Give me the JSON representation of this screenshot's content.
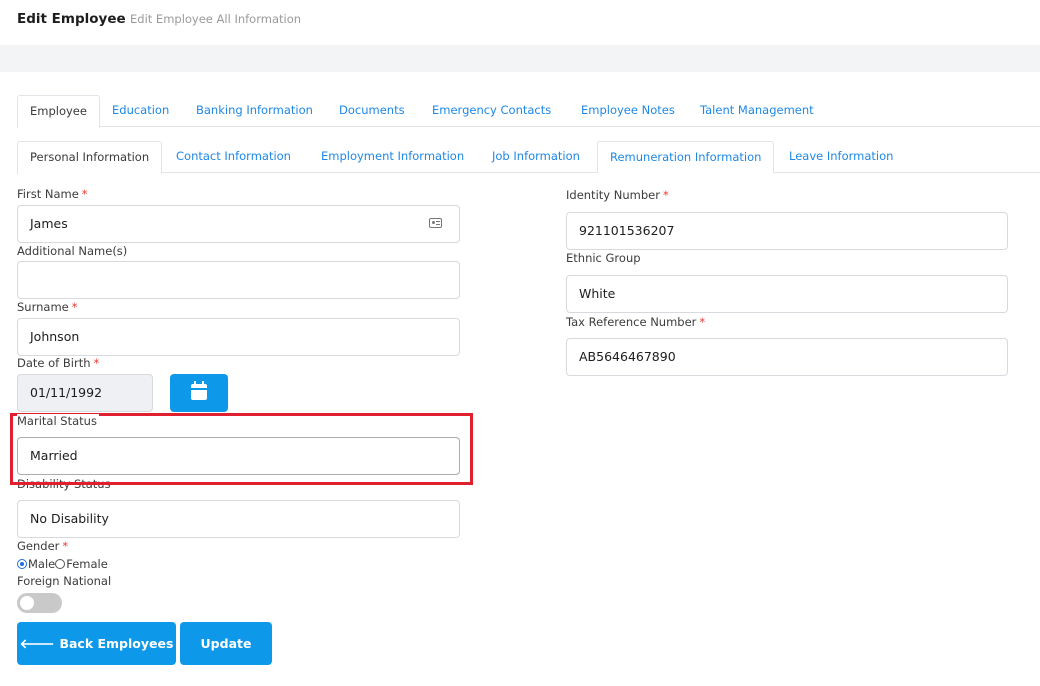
{
  "header": {
    "title": "Edit Employee",
    "subtitle": "Edit Employee All Information"
  },
  "tabs": [
    {
      "label": "Employee",
      "active": true
    },
    {
      "label": "Education"
    },
    {
      "label": "Banking Information"
    },
    {
      "label": "Documents"
    },
    {
      "label": "Emergency Contacts"
    },
    {
      "label": "Employee Notes"
    },
    {
      "label": "Talent Management"
    }
  ],
  "subtabs": [
    {
      "label": "Personal Information",
      "active": true
    },
    {
      "label": "Contact Information"
    },
    {
      "label": "Employment Information"
    },
    {
      "label": "Job Information"
    },
    {
      "label": "Remuneration Information"
    },
    {
      "label": "Leave Information"
    }
  ],
  "form": {
    "first_name": {
      "label": "First Name",
      "required": "*",
      "value": "James"
    },
    "additional_names": {
      "label": "Additional Name(s)",
      "value": ""
    },
    "surname": {
      "label": "Surname",
      "required": "*",
      "value": "Johnson"
    },
    "dob": {
      "label": "Date of Birth",
      "required": "*",
      "value": "01/11/1992"
    },
    "marital_status": {
      "label": "Marital Status",
      "value": "Married"
    },
    "disability_status": {
      "label": "Disability Status",
      "value": "No Disability"
    },
    "gender": {
      "label": "Gender",
      "required": "*",
      "options": [
        "Male",
        "Female"
      ],
      "selected": "Male"
    },
    "foreign_national": {
      "label": "Foreign National",
      "checked": false
    },
    "identity_number": {
      "label": "Identity Number",
      "required": "*",
      "value": "921101536207"
    },
    "ethnic_group": {
      "label": "Ethnic Group",
      "value": "White"
    },
    "tax_reference": {
      "label": "Tax Reference Number",
      "required": "*",
      "value": "AB5646467890"
    }
  },
  "buttons": {
    "back": {
      "arrow": "🡐",
      "label": "Back Employees"
    },
    "update": "Update"
  },
  "colors": {
    "accent": "#0d98e9",
    "link": "#1e88e5",
    "required": "#e53935",
    "highlight": "#e0202f"
  }
}
